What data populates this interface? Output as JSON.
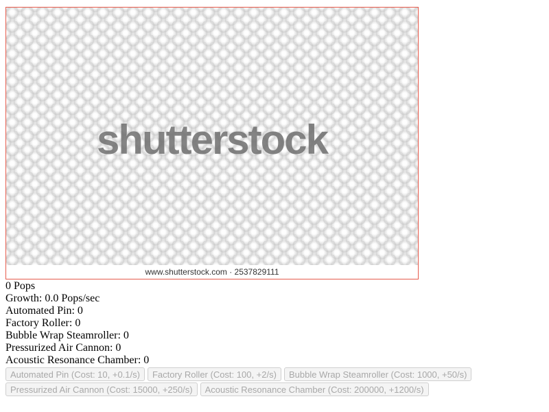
{
  "clicker": {
    "watermark": "shutterstock",
    "footer": "www.shutterstock.com · 2537829111",
    "border_color": "#e65a4b"
  },
  "stats": {
    "pops": "0 Pops",
    "growth": "Growth: 0.0 Pops/sec",
    "automated_pin": "Automated Pin: 0",
    "factory_roller": "Factory Roller: 0",
    "steamroller": "Bubble Wrap Steamroller: 0",
    "air_cannon": "Pressurized Air Cannon: 0",
    "resonance_chamber": "Acoustic Resonance Chamber: 0"
  },
  "upgrades": {
    "automated_pin": "Automated Pin (Cost: 10, +0.1/s)",
    "factory_roller": "Factory Roller (Cost: 100, +2/s)",
    "steamroller": "Bubble Wrap Steamroller (Cost: 1000, +50/s)",
    "air_cannon": "Pressurized Air Cannon (Cost: 15000, +250/s)",
    "resonance_chamber": "Acoustic Resonance Chamber (Cost: 200000, +1200/s)"
  }
}
